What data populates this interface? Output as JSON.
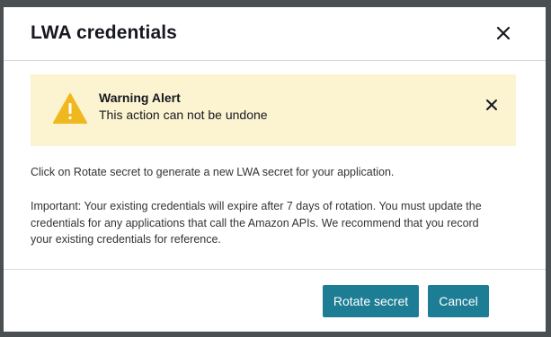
{
  "modal": {
    "title": "LWA credentials"
  },
  "alert": {
    "title": "Warning Alert",
    "message": "This action can not be undone",
    "icon": "warning-triangle-icon",
    "background_color": "#fcf3d0",
    "icon_color": "#f0b81f"
  },
  "content": {
    "paragraph1": "Click on Rotate secret to generate a new LWA secret for your application.",
    "paragraph2_line1": "Important: Your existing credentials will expire after 7 days of rotation. You must update the",
    "paragraph2_line2": "credentials for any applications that call the Amazon APIs. We recommend that you record",
    "paragraph2_line3": "your existing credentials for reference."
  },
  "footer": {
    "rotate_label": "Rotate secret",
    "cancel_label": "Cancel",
    "button_color": "#1d7d94"
  }
}
